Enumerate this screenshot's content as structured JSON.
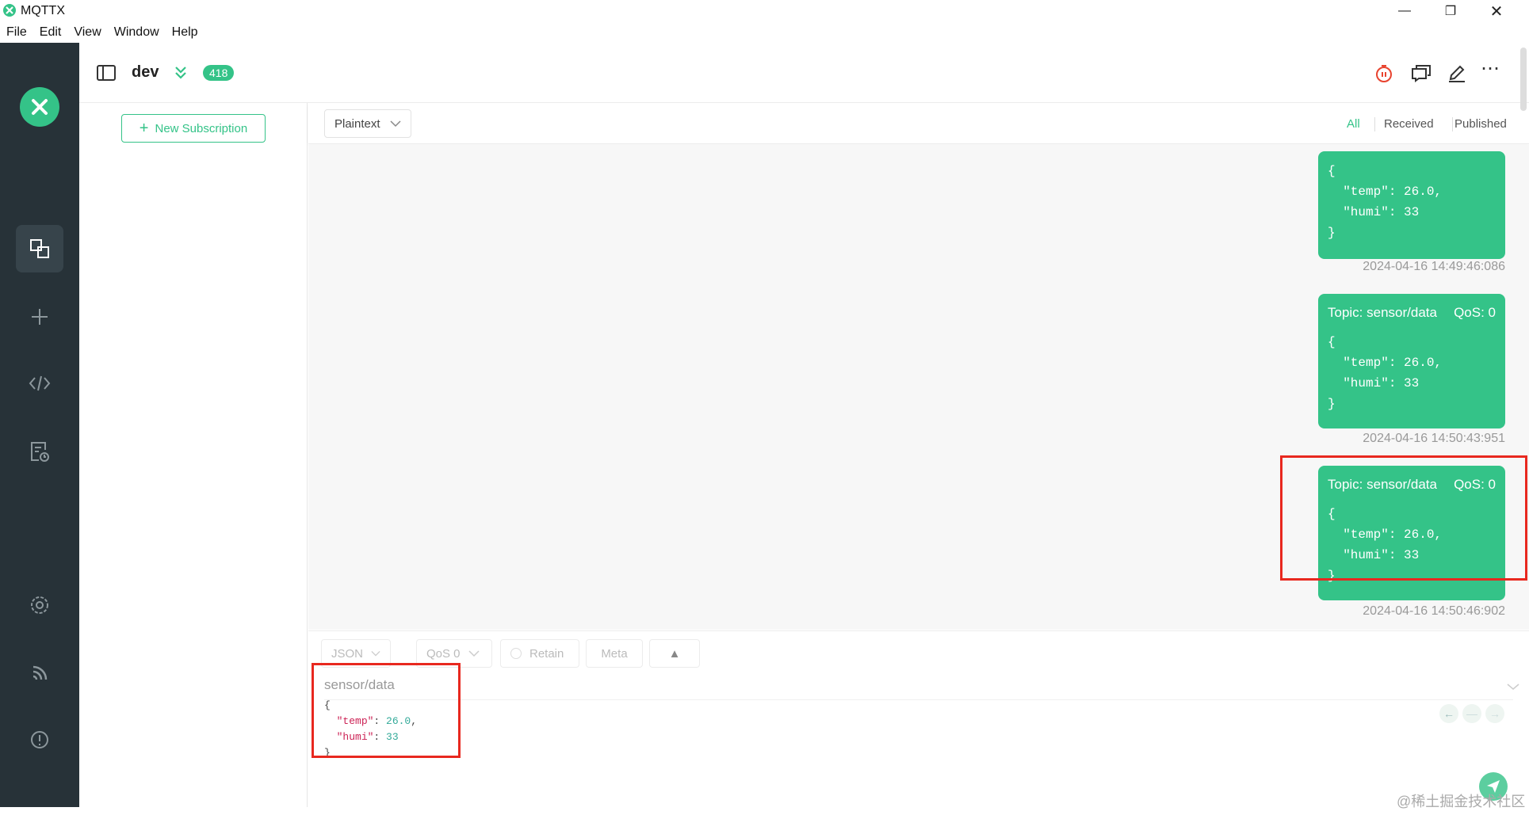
{
  "window": {
    "title": "MQTTX"
  },
  "menu": [
    "File",
    "Edit",
    "View",
    "Window",
    "Help"
  ],
  "header": {
    "connection_name": "dev",
    "message_count": "418"
  },
  "subscriptions": {
    "new_button": "New Subscription"
  },
  "toolbar": {
    "payload_format": "Plaintext",
    "filters": [
      "All",
      "Received",
      "Published"
    ],
    "active_filter": "All"
  },
  "messages": [
    {
      "topic": "",
      "qos": "",
      "payload": "{\n  \"temp\": 26.0,\n  \"humi\": 33\n}",
      "time": "2024-04-16 14:49:46:086"
    },
    {
      "topic": "Topic: sensor/data",
      "qos": "QoS: 0",
      "payload": "{\n  \"temp\": 26.0,\n  \"humi\": 33\n}",
      "time": "2024-04-16 14:50:43:951"
    },
    {
      "topic": "Topic: sensor/data",
      "qos": "QoS: 0",
      "payload": "{\n  \"temp\": 26.0,\n  \"humi\": 33\n}",
      "time": "2024-04-16 14:50:46:902"
    }
  ],
  "composer": {
    "format": "JSON",
    "qos": "QoS 0",
    "retain": "Retain",
    "meta": "Meta",
    "topic": "sensor/data",
    "payload_open": "{",
    "payload_key1": "\"temp\"",
    "payload_val1": "26.0",
    "payload_key2": "\"humi\"",
    "payload_val2": "33",
    "payload_close": "}"
  },
  "watermark": "@稀土掘金技术社区",
  "colors": {
    "accent": "#34c388",
    "rail": "#273238",
    "highlight": "#e8281f"
  }
}
